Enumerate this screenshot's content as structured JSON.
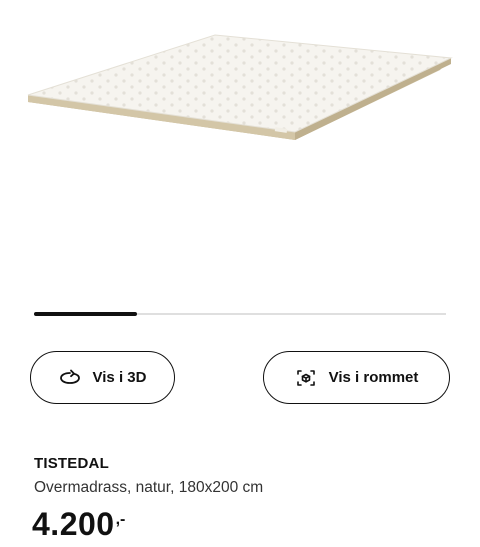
{
  "product": {
    "name": "TISTEDAL",
    "description": "Overmadrass, natur, 180x200 cm",
    "price": "4.200",
    "price_suffix": ",-"
  },
  "gallery": {
    "progress": 0.25
  },
  "actions": {
    "view_3d_label": "Vis i 3D",
    "view_in_room_label": "Vis i rommet",
    "view_3d_icon": "rotate-icon",
    "view_in_room_icon": "ar-cube-icon"
  },
  "colors": {
    "accent": "#111111",
    "mattress_top": "#f7f5f0",
    "mattress_edge": "#cdbf9f"
  }
}
